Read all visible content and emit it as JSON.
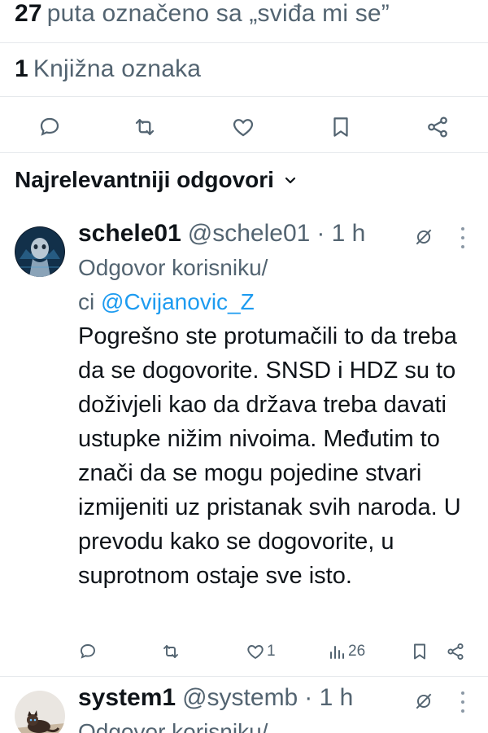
{
  "stats": {
    "likes_count": "27",
    "likes_label": "puta označeno sa „sviđa mi se”",
    "bookmarks_count": "1",
    "bookmarks_label": "Knjižna oznaka"
  },
  "action_icons": [
    "comment-icon",
    "retweet-icon",
    "heart-icon",
    "bookmark-icon",
    "share-icon"
  ],
  "sort": {
    "label": "Najrelevantniji odgovori"
  },
  "replies": [
    {
      "name": "schele01",
      "handle": "@schele01",
      "time": "· 1 h",
      "reply_prefix": "Odgovor korisniku/",
      "reply_prefix2": "ci",
      "reply_mention": "@Cvijanovic_Z",
      "text": "Pogrešno ste protumačili to da treba da se dogovorite. SNSD i HDZ su to doživjeli kao da država treba davati ustupke nižim nivoima. Međutim to znači da se mogu pojedine stvari izmijeniti uz pristanak svih naroda. U prevodu kako se dogovorite, u suprotnom ostaje sve isto.",
      "likes": "1",
      "views": "26"
    },
    {
      "name": "system1",
      "handle": "@systemb",
      "time": "· 1 h",
      "reply_prefix": "Odgovor korisniku/"
    }
  ],
  "colors": {
    "text": "#0f1419",
    "secondary": "#536471",
    "link": "#1d9bf0",
    "divider": "#e6e9ec"
  }
}
